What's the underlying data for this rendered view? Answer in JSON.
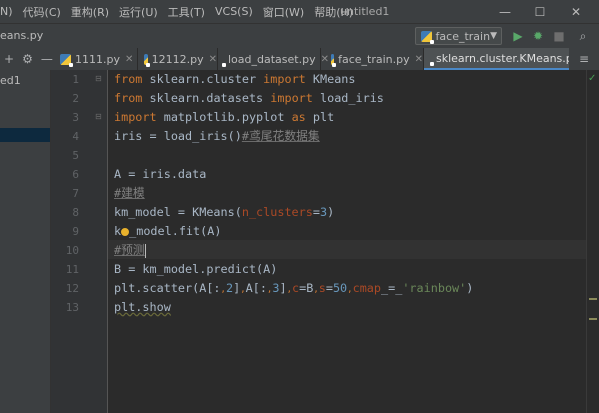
{
  "menubar": {
    "items": [
      "N)",
      "代码(C)",
      "重构(R)",
      "运行(U)",
      "工具(T)",
      "VCS(S)",
      "窗口(W)",
      "帮助(H)"
    ],
    "title": "untitled1",
    "controls": [
      "—",
      "☐",
      "✕"
    ]
  },
  "navbar": {
    "crumb": "eans.py",
    "run_config": "face_train"
  },
  "tabs": [
    {
      "label": "1111.py"
    },
    {
      "label": "12112.py"
    },
    {
      "label": "load_dataset.py"
    },
    {
      "label": "face_train.py"
    },
    {
      "label": "sklearn.cluster.KMeans.py"
    }
  ],
  "project": {
    "root_fragment": "ed1"
  },
  "gutter": {
    "line_numbers": [
      "1",
      "2",
      "3",
      "4",
      "5",
      "6",
      "7",
      "8",
      "9",
      "10",
      "11",
      "12",
      "13"
    ]
  },
  "code": {
    "l1": {
      "kw1": "from",
      "mod": " sklearn.cluster ",
      "kw2": "import",
      "name": " KMeans"
    },
    "l2": {
      "kw1": "from",
      "mod": " sklearn.datasets ",
      "kw2": "import",
      "name": " load_iris"
    },
    "l3": {
      "kw1": "import",
      "mod": " matplotlib.pyplot ",
      "kw2": "as",
      "name": " plt"
    },
    "l4": {
      "code": "iris = load_iris()",
      "comment": "#鸢尾花数据集"
    },
    "l6": {
      "code": "A = iris.data"
    },
    "l7": {
      "comment": "#建模"
    },
    "l8": {
      "pre": "km_model = KMeans(",
      "param": "n_clusters",
      "eq": "=",
      "num": "3",
      "post": ")"
    },
    "l9": {
      "pre": "k",
      "post": "_model.fit(A)"
    },
    "l10": {
      "comment": "#预测"
    },
    "l11": {
      "code": "B = km_model.predict(A)"
    },
    "l12": {
      "a": "plt.scatter(A[:",
      "c1": ",",
      "n1": "2",
      "b": "]",
      "c2": ",",
      "d": "A[:",
      "c3": ",",
      "n2": "3",
      "e": "]",
      "c4": ",",
      "p1": "c",
      "f": "=B",
      "c5": ",",
      "p2": "s",
      "g": "=",
      "n3": "50",
      "c6": ",",
      "p3": "cmap",
      "h": "_=_",
      "s1": "'rainbow'",
      "i": ")"
    },
    "l13": {
      "code": "plt.show"
    }
  }
}
